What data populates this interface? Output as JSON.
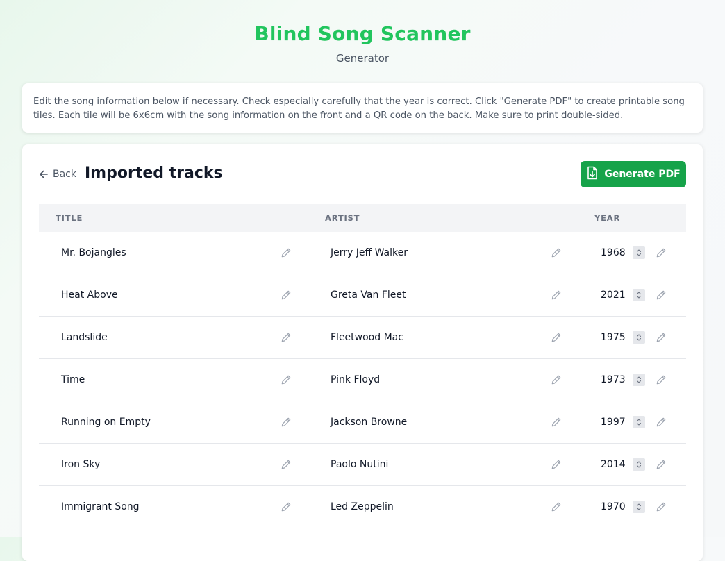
{
  "header": {
    "title": "Blind Song Scanner",
    "subtitle": "Generator"
  },
  "info": {
    "text": "Edit the song information below if necessary. Check especially carefully that the year is correct. Click \"Generate PDF\" to create printable song tiles. Each tile will be 6x6cm with the song information on the front and a QR code on the back. Make sure to print double-sided."
  },
  "toolbar": {
    "back_label": "Back",
    "section_title": "Imported tracks",
    "generate_label": "Generate PDF"
  },
  "table": {
    "columns": [
      "TITLE",
      "ARTIST",
      "YEAR"
    ],
    "rows": [
      {
        "title": "Mr. Bojangles",
        "artist": "Jerry Jeff Walker",
        "year": "1968"
      },
      {
        "title": "Heat Above",
        "artist": "Greta Van Fleet",
        "year": "2021"
      },
      {
        "title": "Landslide",
        "artist": "Fleetwood Mac",
        "year": "1975"
      },
      {
        "title": "Time",
        "artist": "Pink Floyd",
        "year": "1973"
      },
      {
        "title": "Running on Empty",
        "artist": "Jackson Browne",
        "year": "1997"
      },
      {
        "title": "Iron Sky",
        "artist": "Paolo Nutini",
        "year": "2014"
      },
      {
        "title": "Immigrant Song",
        "artist": "Led Zeppelin",
        "year": "1970"
      }
    ]
  },
  "colors": {
    "brand": "#22c55e",
    "button": "#16a34a"
  },
  "icons": {
    "back": "arrow-left-icon",
    "generate": "file-download-icon",
    "edit": "pencil-icon",
    "spinner": "spinner-arrows-icon"
  }
}
